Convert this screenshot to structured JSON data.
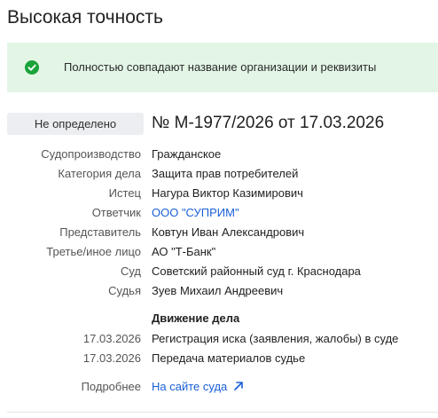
{
  "header": {
    "title": "Высокая точность"
  },
  "banner": {
    "text": "Полностью совпадают название организации и реквизиты",
    "icon": "check-circle-icon",
    "background": "#e3f6e6",
    "icon_color": "#1aa33a"
  },
  "case": {
    "status": "Не определено",
    "number": "№ М-1977/2026 от 17.03.2026"
  },
  "details": [
    {
      "label": "Судопроизводство",
      "value": "Гражданское"
    },
    {
      "label": "Категория дела",
      "value": "Защита прав потребителей"
    },
    {
      "label": "Истец",
      "value": "Нагура Виктор Казимирович"
    },
    {
      "label": "Ответчик",
      "value": "ООО \"СУПРИМ\""
    },
    {
      "label": "Представитель",
      "value": "Ковтун Иван Александрович"
    },
    {
      "label": "Третье/иное лицо",
      "value": "АО \"Т-Банк\""
    },
    {
      "label": "Суд",
      "value": "Советский районный суд г. Краснодара"
    },
    {
      "label": "Судья",
      "value": "Зуев Михаил Андреевич"
    }
  ],
  "movement": {
    "title": "Движение дела",
    "events": [
      {
        "date": "17.03.2026",
        "text": "Регистрация иска (заявления, жалобы) в суде"
      },
      {
        "date": "17.03.2026",
        "text": "Передача материалов судье"
      }
    ]
  },
  "more": {
    "label": "Подробнее",
    "link_text": "На сайте суда",
    "icon": "external-link-arrow-icon"
  },
  "colors": {
    "link": "#1a5fd6",
    "badge_bg": "#eceef1"
  }
}
